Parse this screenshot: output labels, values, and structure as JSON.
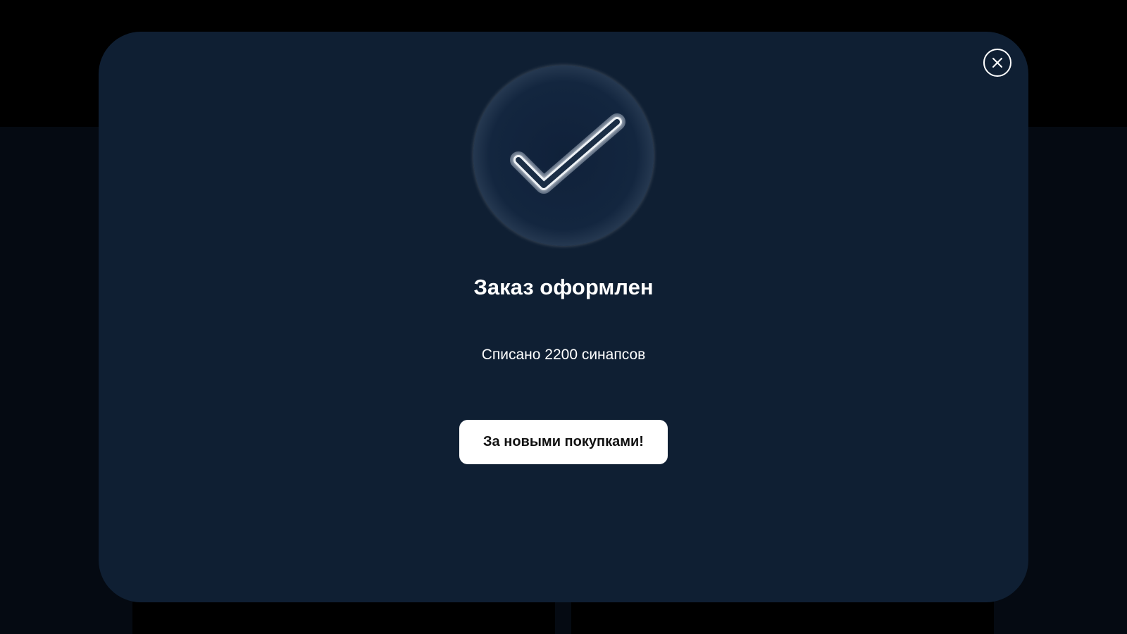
{
  "modal": {
    "title": "Заказ оформлен",
    "message": "Списано 2200 синапсов",
    "primary_button_label": "За новыми покупками!",
    "close_icon": "close-icon",
    "status_icon": "checkmark-icon"
  },
  "colors": {
    "page_background": "#000000",
    "modal_background": "#0f1f33",
    "text": "#ffffff",
    "button_background": "#ffffff",
    "button_text": "#111111"
  }
}
